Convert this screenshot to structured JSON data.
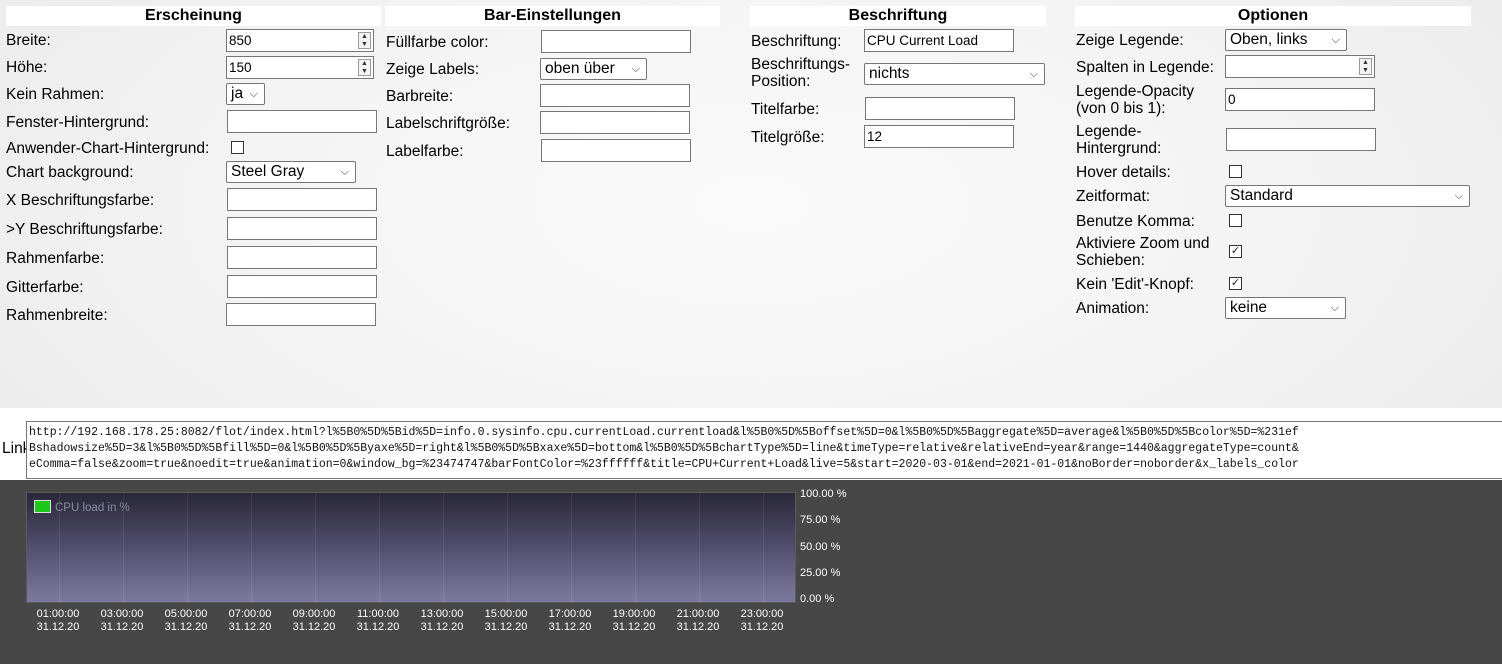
{
  "erscheinung": {
    "title": "Erscheinung",
    "breite_label": "Breite:",
    "breite_value": "850",
    "hoehe_label": "Höhe:",
    "hoehe_value": "150",
    "kein_rahmen_label": "Kein Rahmen:",
    "kein_rahmen_value": "ja",
    "fenster_bg_label": "Fenster-Hintergrund:",
    "anwender_bg_label": "Anwender-Chart-Hintergrund:",
    "chart_bg_label": "Chart background:",
    "chart_bg_value": "Steel Gray",
    "x_color_label": "X Beschriftungsfarbe:",
    "y_color_label": ">Y Beschriftungsfarbe:",
    "rahmenfarbe_label": "Rahmenfarbe:",
    "gitterfarbe_label": "Gitterfarbe:",
    "rahmenbreite_label": "Rahmenbreite:"
  },
  "bar": {
    "title": "Bar-Einstellungen",
    "fuellfarbe_label": "Füllfarbe color:",
    "zeige_labels_label": "Zeige Labels:",
    "zeige_labels_value": "oben über",
    "barbreite_label": "Barbreite:",
    "labelschrift_label": "Labelschriftgröße:",
    "labelfarbe_label": "Labelfarbe:"
  },
  "beschriftung": {
    "title": "Beschriftung",
    "beschriftung_label": "Beschriftung:",
    "beschriftung_value": "CPU Current Load",
    "position_label_1": "Beschriftungs-",
    "position_label_2": "Position:",
    "position_value": "nichts",
    "titelfarbe_label": "Titelfarbe:",
    "titelgroesse_label": "Titelgröße:",
    "titelgroesse_value": "12"
  },
  "optionen": {
    "title": "Optionen",
    "legende_label": "Zeige Legende:",
    "legende_value": "Oben, links",
    "spalten_label": "Spalten in Legende:",
    "opacity_label_1": "Legende-Opacity",
    "opacity_label_2": "(von 0 bis 1):",
    "opacity_value": "0",
    "legende_bg_label_1": "Legende-",
    "legende_bg_label_2": "Hintergrund:",
    "hover_label": "Hover details:",
    "hover_checked": false,
    "zeitformat_label": "Zeitformat:",
    "zeitformat_value": "Standard",
    "komma_label": "Benutze Komma:",
    "komma_checked": false,
    "zoom_label_1": "Aktiviere Zoom und",
    "zoom_label_2": "Schieben:",
    "zoom_checked": true,
    "noedit_label": "Kein 'Edit'-Knopf:",
    "noedit_checked": true,
    "animation_label": "Animation:",
    "animation_value": "keine"
  },
  "link": {
    "label": "Link",
    "line1": "http://192.168.178.25:8082/flot/index.html?l%5B0%5D%5Bid%5D=info.0.sysinfo.cpu.currentLoad.currentload&l%5B0%5D%5Boffset%5D=0&l%5B0%5D%5Baggregate%5D=average&l%5B0%5D%5Bcolor%5D=%231ef",
    "line2": "Bshadowsize%5D=3&l%5B0%5D%5Bfill%5D=0&l%5B0%5D%5Byaxe%5D=right&l%5B0%5D%5Bxaxe%5D=bottom&l%5B0%5D%5BchartType%5D=line&timeType=relative&relativeEnd=year&range=1440&aggregateType=count&",
    "line3": "eComma=false&zoom=true&noedit=true&animation=0&window_bg=%23474747&barFontColor=%23ffffff&title=CPU+Current+Load&live=5&start=2020-03-01&end=2021-01-01&noBorder=noborder&x_labels_color"
  },
  "chart_data": {
    "type": "line",
    "legend": "CPU load in %",
    "legend_color": "#1cc71c",
    "legend_position": "top-left",
    "yaxis_position": "right",
    "y_ticks": [
      "100.00 %",
      "75.00 %",
      "50.00 %",
      "25.00 %",
      "0.00 %"
    ],
    "ylim": [
      0,
      100
    ],
    "x_ticks": [
      {
        "time": "01:00:00",
        "date": "31.12.20"
      },
      {
        "time": "03:00:00",
        "date": "31.12.20"
      },
      {
        "time": "05:00:00",
        "date": "31.12.20"
      },
      {
        "time": "07:00:00",
        "date": "31.12.20"
      },
      {
        "time": "09:00:00",
        "date": "31.12.20"
      },
      {
        "time": "11:00:00",
        "date": "31.12.20"
      },
      {
        "time": "13:00:00",
        "date": "31.12.20"
      },
      {
        "time": "15:00:00",
        "date": "31.12.20"
      },
      {
        "time": "17:00:00",
        "date": "31.12.20"
      },
      {
        "time": "19:00:00",
        "date": "31.12.20"
      },
      {
        "time": "21:00:00",
        "date": "31.12.20"
      },
      {
        "time": "23:00:00",
        "date": "31.12.20"
      }
    ],
    "series": [
      {
        "name": "CPU load in %",
        "values": []
      }
    ],
    "colors": {
      "window_bg": "#474747",
      "font": "#ffffff"
    }
  }
}
